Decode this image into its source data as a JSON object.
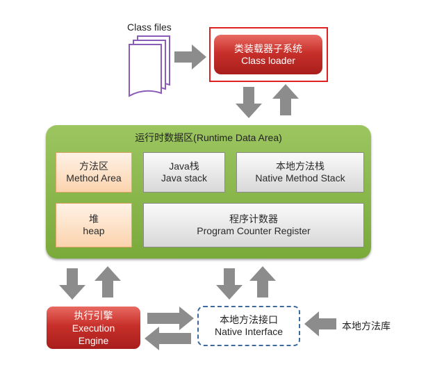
{
  "class_files": {
    "label": "Class files"
  },
  "class_loader": {
    "line1": "类装载器子系统",
    "line2": "Class loader"
  },
  "runtime_data_area": {
    "title": "运行时数据区(Runtime Data Area)",
    "method_area": {
      "line1": "方法区",
      "line2": "Method Area"
    },
    "java_stack": {
      "line1": "Java栈",
      "line2": "Java stack"
    },
    "native_method_stack": {
      "line1": "本地方法栈",
      "line2": "Native Method Stack"
    },
    "heap": {
      "line1": "堆",
      "line2": "heap"
    },
    "pc_register": {
      "line1": "程序计数器",
      "line2": "Program Counter Register"
    }
  },
  "execution_engine": {
    "line1": "执行引擎",
    "line2": "Execution",
    "line3": "Engine"
  },
  "native_interface": {
    "line1": "本地方法接口",
    "line2": "Native Interface"
  },
  "native_library": {
    "label": "本地方法库"
  },
  "colors": {
    "red_box": "#c8302a",
    "green_area": "#8cb84e",
    "orange_fill": "#fbd3ad",
    "gray_fill": "#dcdcdc",
    "arrow_gray": "#8c8c8c",
    "frame_red": "#e02020",
    "dashed_blue": "#3b6aa0",
    "doc_purple": "#8a5cb8"
  }
}
